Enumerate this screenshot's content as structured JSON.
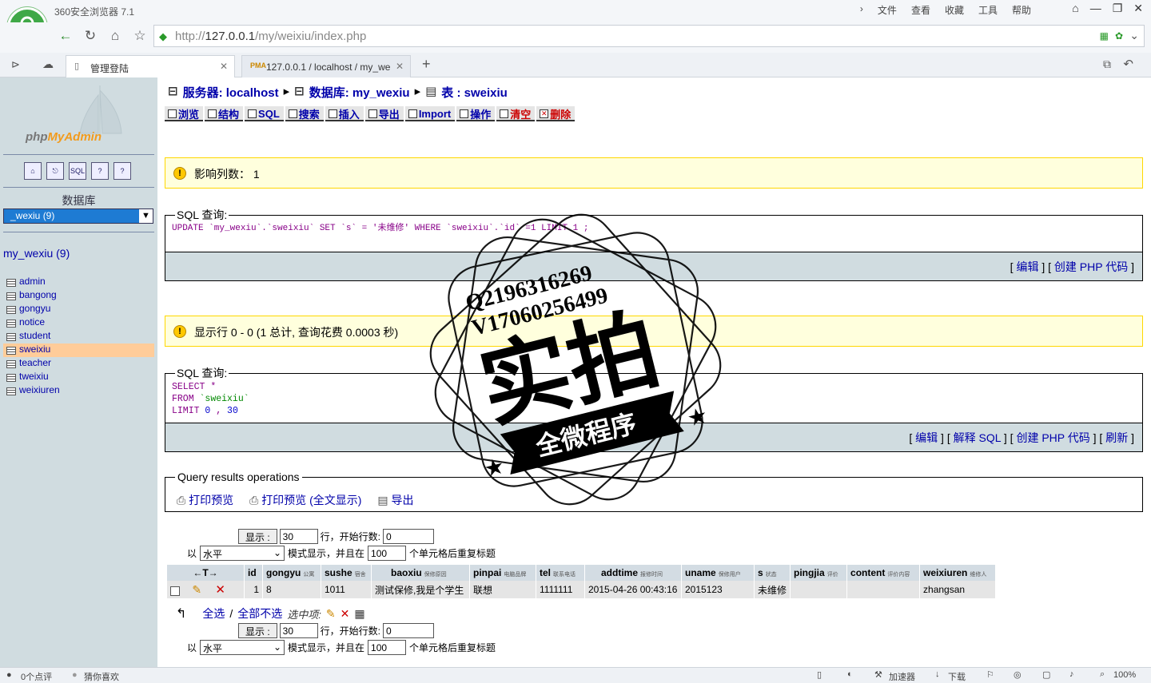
{
  "browser": {
    "name": "360安全浏览器 7.1",
    "menu": [
      "文件",
      "查看",
      "收藏",
      "工具",
      "帮助"
    ],
    "url_prefix": "http://",
    "url_host": "127.0.0.1",
    "url_path": "/my/weixiu/index.php",
    "tabs": [
      {
        "label": "管理登陆",
        "active": true
      },
      {
        "label": "127.0.0.1 / localhost / my_we",
        "active": false
      }
    ],
    "status_left": [
      "0个点评",
      "猜你喜欢"
    ],
    "status_right": [
      "加速器",
      "下载"
    ],
    "zoom": "100%"
  },
  "nav": {
    "logo_php": "php",
    "logo_admin": "MyAdmin",
    "db_label": "数据库",
    "db_selected": "_wexiu (9)",
    "db_title": "my_wexiu (9)",
    "tables": [
      "admin",
      "bangong",
      "gongyu",
      "notice",
      "student",
      "sweixiu",
      "teacher",
      "tweixiu",
      "weixiuren"
    ],
    "selected_table": "sweixiu"
  },
  "breadcrumb": {
    "server": "服务器: localhost",
    "database": "数据库: my_wexiu",
    "table": "表 : sweixiu"
  },
  "tabs": [
    {
      "label": "浏览",
      "red": false
    },
    {
      "label": "结构",
      "red": false
    },
    {
      "label": "SQL",
      "red": false
    },
    {
      "label": "搜索",
      "red": false
    },
    {
      "label": "插入",
      "red": false
    },
    {
      "label": "导出",
      "red": false
    },
    {
      "label": "Import",
      "red": false
    },
    {
      "label": "操作",
      "red": false
    },
    {
      "label": "清空",
      "red": true
    },
    {
      "label": "删除",
      "red": true
    }
  ],
  "notice1": "影响列数： 1",
  "sql1": {
    "legend": "SQL 查询:",
    "query": "UPDATE `my_wexiu`.`sweixiu` SET `s` = '未维修' WHERE `sweixiu`.`id` =1 LIMIT 1 ;",
    "links": [
      "编辑",
      "创建 PHP 代码"
    ]
  },
  "notice2": "显示行 0 - 0 (1 总计, 查询花费 0.0003 秒)",
  "sql2": {
    "legend": "SQL 查询:",
    "line1_kw": "SELECT",
    "line1_rest": " *",
    "line2_kw": "FROM",
    "line2_rest": " `sweixiu`",
    "line3_kw": "LIMIT",
    "line3_a": "0",
    "line3_sep": " , ",
    "line3_b": "30",
    "links": [
      "编辑",
      "解释 SQL",
      "创建 PHP 代码",
      "刷新"
    ]
  },
  "qro": {
    "legend": "Query results operations",
    "links": [
      "打印预览",
      "打印预览 (全文显示)",
      "导出"
    ]
  },
  "controls": {
    "show_btn": "显示 :",
    "rows": "30",
    "rows_label": "行，开始行数:",
    "start": "0",
    "mode_prefix": "以",
    "mode": "水平",
    "mode_label": "模式显示，并且在",
    "repeat": "100",
    "repeat_label": "个单元格后重复标题"
  },
  "results": {
    "columns": [
      {
        "name": "id",
        "comment": ""
      },
      {
        "name": "gongyu",
        "comment": "公寓"
      },
      {
        "name": "sushe",
        "comment": "宿舍"
      },
      {
        "name": "baoxiu",
        "comment": "保修原因"
      },
      {
        "name": "pinpai",
        "comment": "电脑品牌"
      },
      {
        "name": "tel",
        "comment": "联系电话"
      },
      {
        "name": "addtime",
        "comment": "报修时间"
      },
      {
        "name": "uname",
        "comment": "保修用户"
      },
      {
        "name": "s",
        "comment": "状态"
      },
      {
        "name": "pingjia",
        "comment": "评价"
      },
      {
        "name": "content",
        "comment": "评价内容"
      },
      {
        "name": "weixiuren",
        "comment": "维修人"
      }
    ],
    "rows": [
      [
        "1",
        "8",
        "1011",
        "测试保修,我是个学生",
        "联想",
        "1111111",
        "2015-04-26 00:43:16",
        "2015123",
        "未维修",
        "",
        "",
        "zhangsan"
      ]
    ]
  },
  "bulk": {
    "check_all": "全选",
    "sep": " / ",
    "uncheck_all": "全部不选",
    "with_selected": "选中项:"
  },
  "stamp": {
    "line1": "Q2196316269",
    "line2": "V17060256499",
    "big": "实拍",
    "banner": "全微程序"
  }
}
